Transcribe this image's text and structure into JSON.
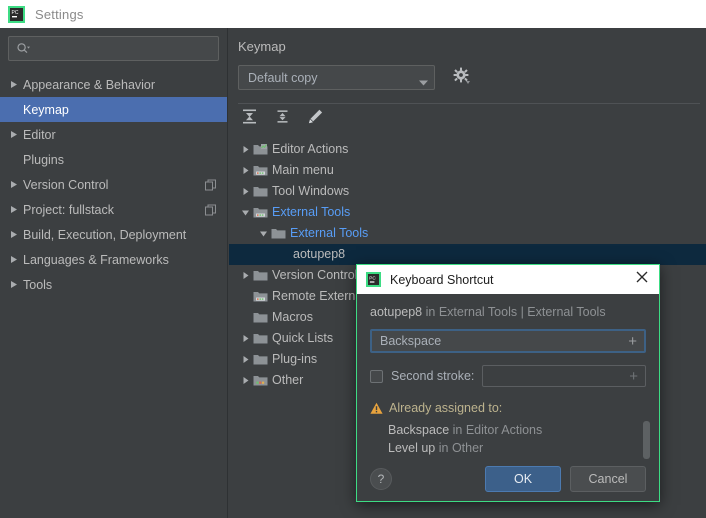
{
  "window": {
    "title": "Settings",
    "logo_icon": "pycharm-logo-icon"
  },
  "sidebar": {
    "search": {
      "placeholder": "",
      "value": "",
      "icon": "search-icon"
    },
    "items": [
      {
        "label": "Appearance & Behavior",
        "expandable": true,
        "selected": false,
        "badge": false
      },
      {
        "label": "Keymap",
        "expandable": false,
        "selected": true,
        "badge": false
      },
      {
        "label": "Editor",
        "expandable": true,
        "selected": false,
        "badge": false
      },
      {
        "label": "Plugins",
        "expandable": false,
        "selected": false,
        "badge": false
      },
      {
        "label": "Version Control",
        "expandable": true,
        "selected": false,
        "badge": true
      },
      {
        "label": "Project: fullstack",
        "expandable": true,
        "selected": false,
        "badge": true
      },
      {
        "label": "Build, Execution, Deployment",
        "expandable": true,
        "selected": false,
        "badge": false
      },
      {
        "label": "Languages & Frameworks",
        "expandable": true,
        "selected": false,
        "badge": false
      },
      {
        "label": "Tools",
        "expandable": true,
        "selected": false,
        "badge": false
      }
    ]
  },
  "main": {
    "title": "Keymap",
    "scheme": {
      "value": "Default copy",
      "caret_icon": "chevron-down-icon",
      "gear_icon": "gear-icon"
    },
    "toolbar": [
      {
        "name": "expand-all-icon",
        "tooltip": "Expand All"
      },
      {
        "name": "collapse-all-icon",
        "tooltip": "Collapse All"
      },
      {
        "name": "edit-shortcut-icon",
        "tooltip": "Edit Shortcut"
      }
    ],
    "tree": [
      {
        "label": "Editor Actions",
        "indent": 0,
        "twisty": "right",
        "icon": "folder-actions-icon",
        "link": false,
        "selected": false
      },
      {
        "label": "Main menu",
        "indent": 0,
        "twisty": "right",
        "icon": "folder-menu-icon",
        "link": false,
        "selected": false
      },
      {
        "label": "Tool Windows",
        "indent": 0,
        "twisty": "right",
        "icon": "folder-icon",
        "link": false,
        "selected": false
      },
      {
        "label": "External Tools",
        "indent": 0,
        "twisty": "down",
        "icon": "folder-tools-icon",
        "link": true,
        "selected": false
      },
      {
        "label": "External Tools",
        "indent": 1,
        "twisty": "down",
        "icon": "folder-icon",
        "link": true,
        "selected": false
      },
      {
        "label": "aotupep8",
        "indent": 2,
        "twisty": "none",
        "icon": "none",
        "link": false,
        "selected": true
      },
      {
        "label": "Version Control",
        "indent": 0,
        "twisty": "right",
        "icon": "folder-icon",
        "link": false,
        "selected": false
      },
      {
        "label": "Remote External Tools",
        "indent": 0,
        "twisty": "none",
        "icon": "folder-tools-icon",
        "link": false,
        "selected": false
      },
      {
        "label": "Macros",
        "indent": 0,
        "twisty": "none",
        "icon": "folder-icon",
        "link": false,
        "selected": false
      },
      {
        "label": "Quick Lists",
        "indent": 0,
        "twisty": "right",
        "icon": "folder-icon",
        "link": false,
        "selected": false
      },
      {
        "label": "Plug-ins",
        "indent": 0,
        "twisty": "right",
        "icon": "folder-icon",
        "link": false,
        "selected": false
      },
      {
        "label": "Other",
        "indent": 0,
        "twisty": "right",
        "icon": "folder-other-icon",
        "link": false,
        "selected": false
      }
    ]
  },
  "dialog": {
    "title": "Keyboard Shortcut",
    "logo_icon": "pycharm-logo-icon",
    "close_icon": "close-icon",
    "context_action": "aotupep8",
    "context_rest": " in External Tools | External Tools",
    "shortcut": {
      "value": "Backspace",
      "plus": "+"
    },
    "second_stroke": {
      "label": "Second stroke:",
      "checked": false,
      "value": "",
      "plus": "+"
    },
    "warning": {
      "icon": "warning-icon",
      "heading": "Already assigned to:",
      "items": [
        {
          "action": "Backspace",
          "rest": " in Editor Actions"
        },
        {
          "action": "Level up",
          "rest": " in Other"
        }
      ]
    },
    "footer": {
      "help_label": "?",
      "ok_label": "OK",
      "cancel_label": "Cancel"
    }
  },
  "colors": {
    "accent_selected": "#4b6eaf",
    "tree_selected": "#0d293e",
    "link": "#589df6",
    "dialog_border": "#3ddc84",
    "warning": "#c8a05a",
    "primary_button": "#3c608a"
  }
}
